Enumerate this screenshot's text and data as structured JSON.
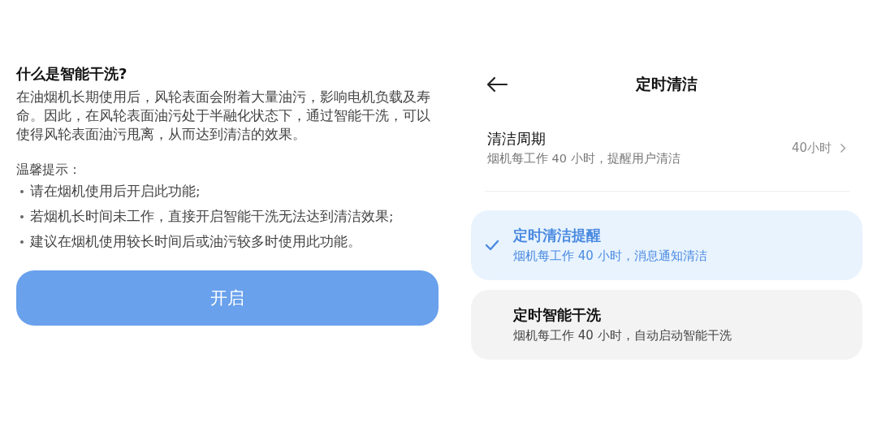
{
  "info": {
    "title": "什么是智能干洗?",
    "description": "在油烟机长期使用后，风轮表面会附着大量油污，影响电机负载及寿命。因此，在风轮表面油污处于半融化状态下，通过智能干洗，可以使得风轮表面油污甩离，从而达到清洁的效果。",
    "tips_label": "温馨提示：",
    "tips": [
      "请在烟机使用后开启此功能;",
      "若烟机长时间未工作，直接开启智能干洗无法达到清洁效果;",
      "建议在烟机使用较长时间后或油污较多时使用此功能。"
    ],
    "button": "开启"
  },
  "settings": {
    "title": "定时清洁",
    "cycle": {
      "label": "清洁周期",
      "description": "烟机每工作 40 小时，提醒用户清洁",
      "value": "40小时"
    },
    "options": [
      {
        "label": "定时清洁提醒",
        "description": "烟机每工作 40 小时，消息通知清洁",
        "selected": true
      },
      {
        "label": "定时智能干洗",
        "description": "烟机每工作 40 小时，自动启动智能干洗",
        "selected": false
      }
    ]
  }
}
